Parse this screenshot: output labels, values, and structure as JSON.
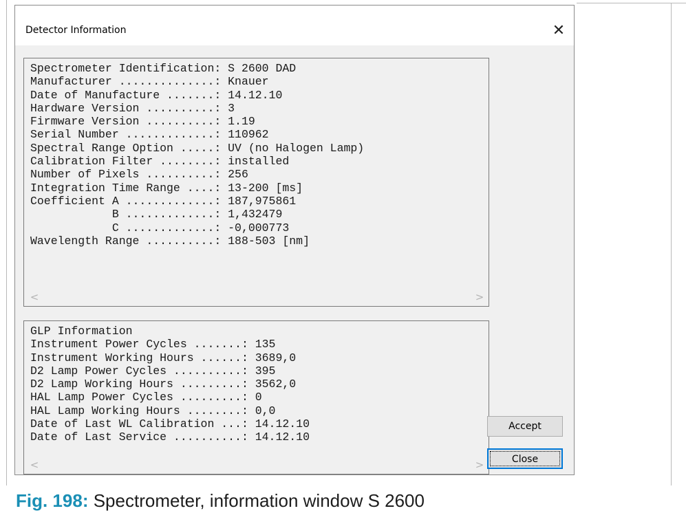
{
  "dialog": {
    "title": "Detector Information",
    "close_glyph": "✕",
    "close_icon": "close-icon"
  },
  "spectrometer_lines": [
    "Spectrometer Identification: S 2600 DAD",
    "Manufacturer ..............: Knauer",
    "Date of Manufacture .......: 14.12.10",
    "Hardware Version ..........: 3",
    "Firmware Version ..........: 1.19",
    "Serial Number .............: 110962",
    "Spectral Range Option .....: UV (no Halogen Lamp)",
    "Calibration Filter ........: installed",
    "Number of Pixels ..........: 256",
    "Integration Time Range ....: 13-200 [ms]",
    "Coefficient A .............: 187,975861",
    "            B .............: 1,432479",
    "            C .............: -0,000773",
    "Wavelength Range ..........: 188-503 [nm]"
  ],
  "glp_lines": [
    "GLP Information",
    "Instrument Power Cycles .......: 135",
    "Instrument Working Hours ......: 3689,0",
    "D2 Lamp Power Cycles ..........: 395",
    "D2 Lamp Working Hours .........: 3562,0",
    "HAL Lamp Power Cycles .........: 0",
    "HAL Lamp Working Hours ........: 0,0",
    "Date of Last WL Calibration ...: 14.12.10",
    "Date of Last Service ..........: 14.12.10"
  ],
  "scrollbar": {
    "left_glyph": "<",
    "right_glyph": ">",
    "left_icon": "chevron-left-icon",
    "right_icon": "chevron-right-icon"
  },
  "buttons": {
    "accept_label": "Accept",
    "close_label": "Close"
  },
  "caption": {
    "label": "Fig. 198:",
    "text": "Spectrometer, information window S 2600"
  },
  "colors": {
    "dialog_background": "#f0f0f0",
    "caption_label": "#1a8fb5",
    "focus_border": "#0078d7"
  }
}
